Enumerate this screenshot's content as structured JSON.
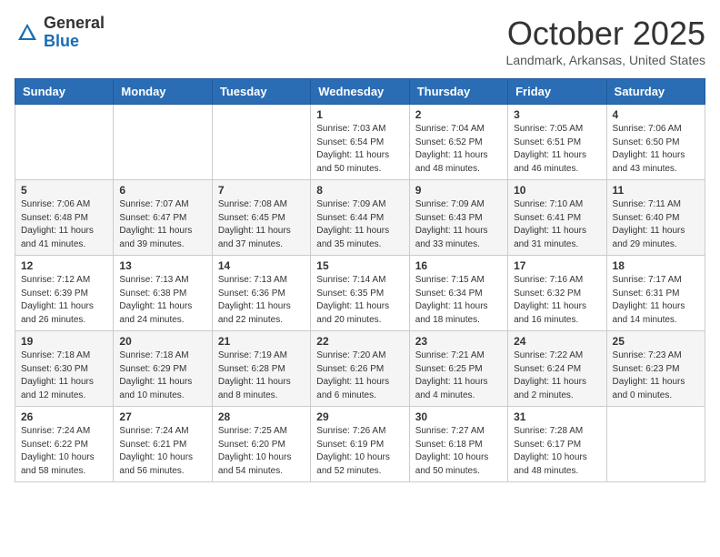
{
  "header": {
    "logo_line1": "General",
    "logo_line2": "Blue",
    "month": "October 2025",
    "location": "Landmark, Arkansas, United States"
  },
  "weekdays": [
    "Sunday",
    "Monday",
    "Tuesday",
    "Wednesday",
    "Thursday",
    "Friday",
    "Saturday"
  ],
  "weeks": [
    [
      {
        "day": "",
        "info": ""
      },
      {
        "day": "",
        "info": ""
      },
      {
        "day": "",
        "info": ""
      },
      {
        "day": "1",
        "info": "Sunrise: 7:03 AM\nSunset: 6:54 PM\nDaylight: 11 hours and 50 minutes."
      },
      {
        "day": "2",
        "info": "Sunrise: 7:04 AM\nSunset: 6:52 PM\nDaylight: 11 hours and 48 minutes."
      },
      {
        "day": "3",
        "info": "Sunrise: 7:05 AM\nSunset: 6:51 PM\nDaylight: 11 hours and 46 minutes."
      },
      {
        "day": "4",
        "info": "Sunrise: 7:06 AM\nSunset: 6:50 PM\nDaylight: 11 hours and 43 minutes."
      }
    ],
    [
      {
        "day": "5",
        "info": "Sunrise: 7:06 AM\nSunset: 6:48 PM\nDaylight: 11 hours and 41 minutes."
      },
      {
        "day": "6",
        "info": "Sunrise: 7:07 AM\nSunset: 6:47 PM\nDaylight: 11 hours and 39 minutes."
      },
      {
        "day": "7",
        "info": "Sunrise: 7:08 AM\nSunset: 6:45 PM\nDaylight: 11 hours and 37 minutes."
      },
      {
        "day": "8",
        "info": "Sunrise: 7:09 AM\nSunset: 6:44 PM\nDaylight: 11 hours and 35 minutes."
      },
      {
        "day": "9",
        "info": "Sunrise: 7:09 AM\nSunset: 6:43 PM\nDaylight: 11 hours and 33 minutes."
      },
      {
        "day": "10",
        "info": "Sunrise: 7:10 AM\nSunset: 6:41 PM\nDaylight: 11 hours and 31 minutes."
      },
      {
        "day": "11",
        "info": "Sunrise: 7:11 AM\nSunset: 6:40 PM\nDaylight: 11 hours and 29 minutes."
      }
    ],
    [
      {
        "day": "12",
        "info": "Sunrise: 7:12 AM\nSunset: 6:39 PM\nDaylight: 11 hours and 26 minutes."
      },
      {
        "day": "13",
        "info": "Sunrise: 7:13 AM\nSunset: 6:38 PM\nDaylight: 11 hours and 24 minutes."
      },
      {
        "day": "14",
        "info": "Sunrise: 7:13 AM\nSunset: 6:36 PM\nDaylight: 11 hours and 22 minutes."
      },
      {
        "day": "15",
        "info": "Sunrise: 7:14 AM\nSunset: 6:35 PM\nDaylight: 11 hours and 20 minutes."
      },
      {
        "day": "16",
        "info": "Sunrise: 7:15 AM\nSunset: 6:34 PM\nDaylight: 11 hours and 18 minutes."
      },
      {
        "day": "17",
        "info": "Sunrise: 7:16 AM\nSunset: 6:32 PM\nDaylight: 11 hours and 16 minutes."
      },
      {
        "day": "18",
        "info": "Sunrise: 7:17 AM\nSunset: 6:31 PM\nDaylight: 11 hours and 14 minutes."
      }
    ],
    [
      {
        "day": "19",
        "info": "Sunrise: 7:18 AM\nSunset: 6:30 PM\nDaylight: 11 hours and 12 minutes."
      },
      {
        "day": "20",
        "info": "Sunrise: 7:18 AM\nSunset: 6:29 PM\nDaylight: 11 hours and 10 minutes."
      },
      {
        "day": "21",
        "info": "Sunrise: 7:19 AM\nSunset: 6:28 PM\nDaylight: 11 hours and 8 minutes."
      },
      {
        "day": "22",
        "info": "Sunrise: 7:20 AM\nSunset: 6:26 PM\nDaylight: 11 hours and 6 minutes."
      },
      {
        "day": "23",
        "info": "Sunrise: 7:21 AM\nSunset: 6:25 PM\nDaylight: 11 hours and 4 minutes."
      },
      {
        "day": "24",
        "info": "Sunrise: 7:22 AM\nSunset: 6:24 PM\nDaylight: 11 hours and 2 minutes."
      },
      {
        "day": "25",
        "info": "Sunrise: 7:23 AM\nSunset: 6:23 PM\nDaylight: 11 hours and 0 minutes."
      }
    ],
    [
      {
        "day": "26",
        "info": "Sunrise: 7:24 AM\nSunset: 6:22 PM\nDaylight: 10 hours and 58 minutes."
      },
      {
        "day": "27",
        "info": "Sunrise: 7:24 AM\nSunset: 6:21 PM\nDaylight: 10 hours and 56 minutes."
      },
      {
        "day": "28",
        "info": "Sunrise: 7:25 AM\nSunset: 6:20 PM\nDaylight: 10 hours and 54 minutes."
      },
      {
        "day": "29",
        "info": "Sunrise: 7:26 AM\nSunset: 6:19 PM\nDaylight: 10 hours and 52 minutes."
      },
      {
        "day": "30",
        "info": "Sunrise: 7:27 AM\nSunset: 6:18 PM\nDaylight: 10 hours and 50 minutes."
      },
      {
        "day": "31",
        "info": "Sunrise: 7:28 AM\nSunset: 6:17 PM\nDaylight: 10 hours and 48 minutes."
      },
      {
        "day": "",
        "info": ""
      }
    ]
  ]
}
